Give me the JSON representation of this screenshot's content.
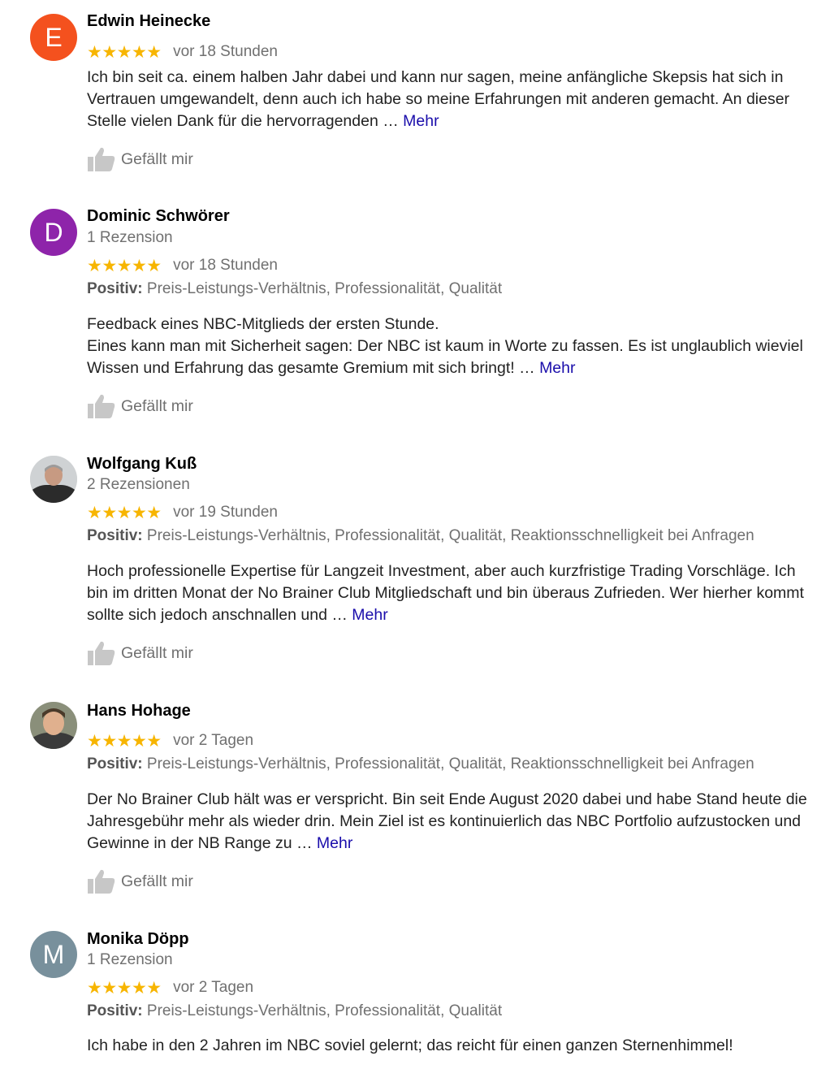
{
  "reviews": [
    {
      "avatar_letter": "E",
      "avatar_color": "#f4511e",
      "name": "Edwin Heinecke",
      "stars": "★★★★★",
      "time": "vor 18 Stunden",
      "text_lines": [
        "Ich bin seit ca. einem halben Jahr dabei und kann nur sagen, meine anfängliche Skepsis hat sich in Vertrauen umgewandelt, denn auch ich habe so meine Erfahrungen  mit anderen gemacht. An dieser Stelle vielen Dank für die hervorragenden …"
      ],
      "more_label": "Mehr",
      "like_label": "Gefällt mir"
    },
    {
      "avatar_letter": "D",
      "avatar_color": "#8e24aa",
      "name": "Dominic Schwörer",
      "review_count": "1 Rezension",
      "stars": "★★★★★",
      "time": "vor 18 Stunden",
      "positive_label": "Positiv:",
      "positive_items": "Preis-Leistungs-Verhältnis, Professionalität, Qualität",
      "text_lines": [
        "Feedback eines NBC-Mitglieds der ersten Stunde.",
        "Eines kann man mit Sicherheit sagen: Der NBC ist kaum in Worte zu fassen. Es ist unglaublich wieviel Wissen und Erfahrung das gesamte Gremium mit sich bringt! …"
      ],
      "more_label": "Mehr",
      "like_label": "Gefällt mir"
    },
    {
      "avatar_type": "photo",
      "name": "Wolfgang Kuß",
      "review_count": "2 Rezensionen",
      "stars": "★★★★★",
      "time": "vor 19 Stunden",
      "positive_label": "Positiv:",
      "positive_items": "Preis-Leistungs-Verhältnis, Professionalität, Qualität, Reaktionsschnelligkeit bei Anfragen",
      "text_lines": [
        "Hoch professionelle Expertise für Langzeit Investment, aber auch kurzfristige Trading Vorschläge. Ich bin im dritten Monat der No Brainer Club Mitgliedschaft und bin überaus Zufrieden. Wer hierher kommt sollte sich jedoch anschnallen und …"
      ],
      "more_label": "Mehr",
      "like_label": "Gefällt mir"
    },
    {
      "avatar_type": "photo",
      "name": "Hans Hohage",
      "stars": "★★★★★",
      "time": "vor 2 Tagen",
      "positive_label": "Positiv:",
      "positive_items": "Preis-Leistungs-Verhältnis, Professionalität, Qualität, Reaktionsschnelligkeit bei Anfragen",
      "text_lines": [
        "Der No Brainer Club hält was er verspricht. Bin seit Ende August 2020 dabei und habe Stand heute die Jahresgebühr mehr als wieder drin. Mein Ziel ist es kontinuierlich das NBC Portfolio aufzustocken und Gewinne in der NB Range zu …"
      ],
      "more_label": "Mehr",
      "like_label": "Gefällt mir"
    },
    {
      "avatar_letter": "M",
      "avatar_color": "#78909c",
      "name": "Monika Döpp",
      "review_count": "1 Rezension",
      "stars": "★★★★★",
      "time": "vor 2 Tagen",
      "positive_label": "Positiv:",
      "positive_items": "Preis-Leistungs-Verhältnis, Professionalität, Qualität",
      "text_lines": [
        "Ich habe in den 2 Jahren im NBC soviel gelernt; das reicht für einen ganzen Sternenhimmel!"
      ]
    }
  ],
  "colors": {
    "star": "#f7b500",
    "more_link": "#1a0dab",
    "muted_text": "#707070",
    "body_text": "#222222"
  }
}
